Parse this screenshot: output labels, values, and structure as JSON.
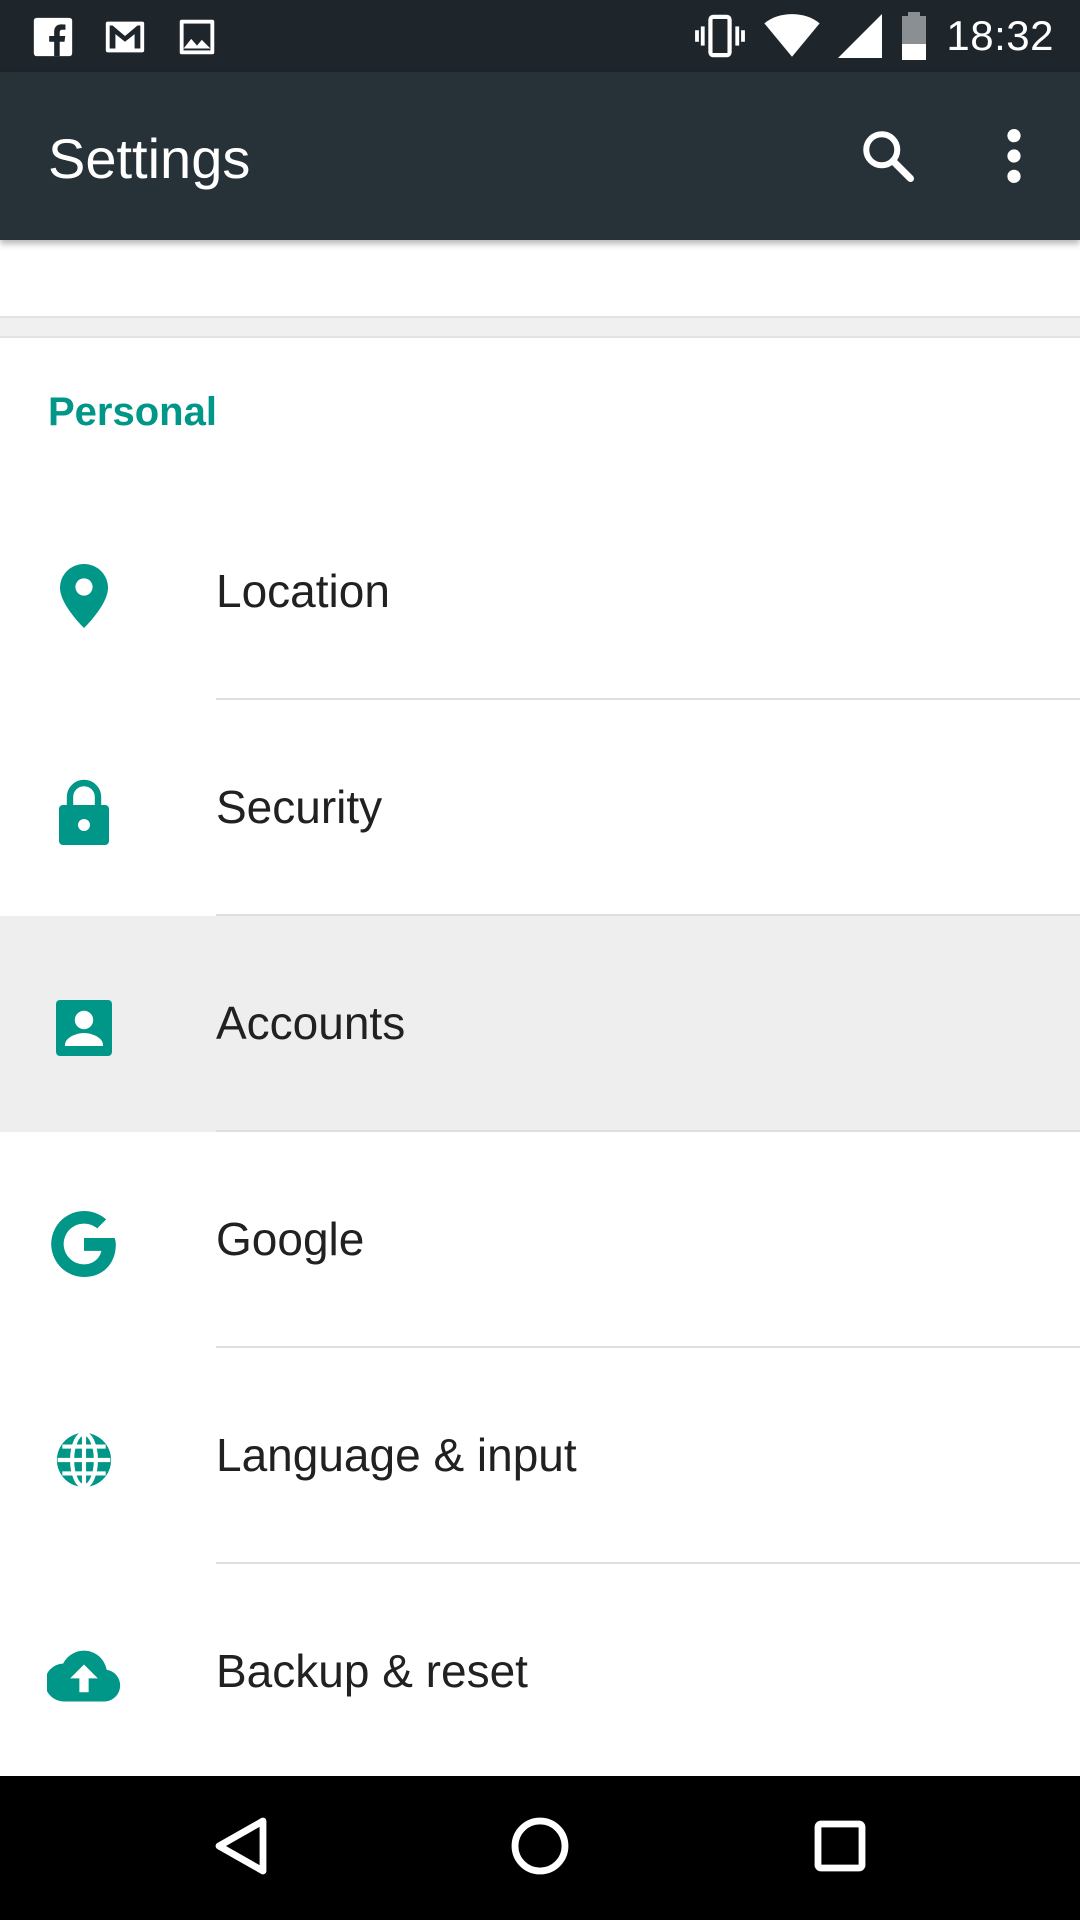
{
  "status_bar": {
    "time": "18:32",
    "notification_icons": [
      "facebook-icon",
      "gmail-icon",
      "image-icon"
    ],
    "system_icons": [
      "vibrate-icon",
      "wifi-icon",
      "signal-icon",
      "battery-icon"
    ]
  },
  "app_bar": {
    "title": "Settings",
    "actions": [
      "search-icon",
      "more-vert-icon"
    ]
  },
  "section": {
    "header": "Personal"
  },
  "items": [
    {
      "label": "Location",
      "icon": "location-pin-icon"
    },
    {
      "label": "Security",
      "icon": "lock-icon"
    },
    {
      "label": "Accounts",
      "icon": "account-box-icon",
      "pressed": true
    },
    {
      "label": "Google",
      "icon": "google-g-icon"
    },
    {
      "label": "Language & input",
      "icon": "globe-icon"
    },
    {
      "label": "Backup & reset",
      "icon": "cloud-upload-icon"
    }
  ],
  "nav_bar": {
    "buttons": [
      "back-icon",
      "home-icon",
      "recents-icon"
    ]
  },
  "colors": {
    "accent": "#009688",
    "app_bar": "#263238",
    "status_bar": "#1f262b",
    "pressed_row": "#eeeeee"
  }
}
